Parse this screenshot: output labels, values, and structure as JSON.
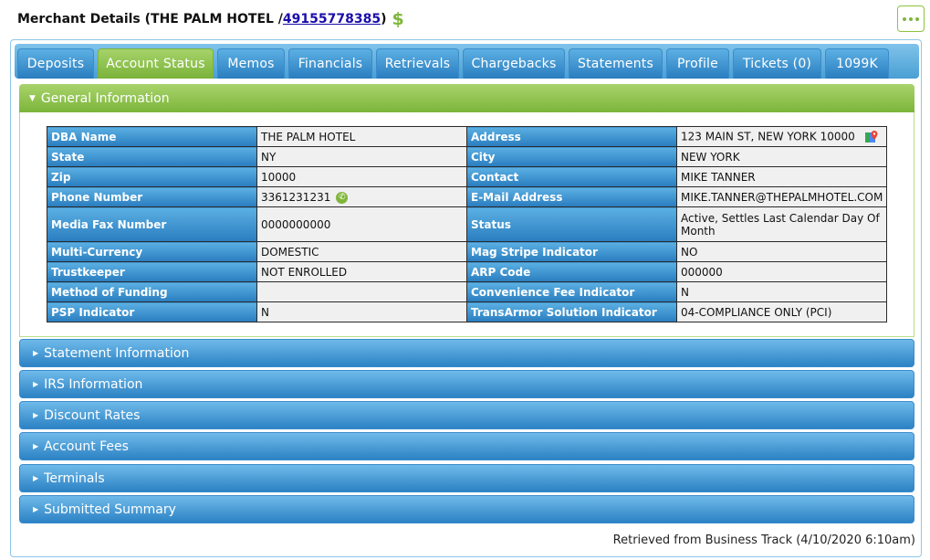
{
  "header": {
    "prefix": "Merchant Details (THE PALM HOTEL / ",
    "merchant_id": "49155778385",
    "suffix": ")",
    "dollar": "$"
  },
  "tabs": [
    {
      "label": "Deposits",
      "active": false
    },
    {
      "label": "Account Status",
      "active": true
    },
    {
      "label": "Memos",
      "active": false
    },
    {
      "label": "Financials",
      "active": false
    },
    {
      "label": "Retrievals",
      "active": false
    },
    {
      "label": "Chargebacks",
      "active": false
    },
    {
      "label": "Statements",
      "active": false
    },
    {
      "label": "Profile",
      "active": false
    },
    {
      "label": "Tickets (0)",
      "active": false
    },
    {
      "label": "1099K",
      "active": false
    }
  ],
  "general": {
    "title": "General Information",
    "rows": [
      {
        "l1": "DBA Name",
        "v1": "THE PALM HOTEL",
        "l2": "Address",
        "v2": "123 MAIN ST, NEW YORK 10000"
      },
      {
        "l1": "State",
        "v1": "NY",
        "l2": "City",
        "v2": "NEW YORK"
      },
      {
        "l1": "Zip",
        "v1": "10000",
        "l2": "Contact",
        "v2": "MIKE TANNER"
      },
      {
        "l1": "Phone Number",
        "v1": "3361231231",
        "l2": "E-Mail Address",
        "v2": "MIKE.TANNER@THEPALMHOTEL.COM"
      },
      {
        "l1": "Media Fax Number",
        "v1": "0000000000",
        "l2": "Status",
        "v2": "Active, Settles Last Calendar Day Of Month"
      },
      {
        "l1": "Multi-Currency",
        "v1": "DOMESTIC",
        "l2": "Mag Stripe Indicator",
        "v2": "NO"
      },
      {
        "l1": "Trustkeeper",
        "v1": "NOT ENROLLED",
        "l2": "ARP Code",
        "v2": "000000"
      },
      {
        "l1": "Method of Funding",
        "v1": "",
        "l2": "Convenience Fee Indicator",
        "v2": "N"
      },
      {
        "l1": "PSP Indicator",
        "v1": "N",
        "l2": "TransArmor Solution Indicator",
        "v2": "04-COMPLIANCE ONLY (PCI)"
      }
    ]
  },
  "sections": [
    "Statement Information",
    "IRS Information",
    "Discount Rates",
    "Account Fees",
    "Terminals",
    "Submitted Summary"
  ],
  "footer": "Retrieved from Business Track (4/10/2020 6:10am)",
  "icons": {
    "phone": "phone-icon",
    "map": "map-pin-icon",
    "more": "more-dots-icon",
    "dollar": "dollar-icon"
  },
  "colors": {
    "green": "#7fb63a",
    "blue": "#2a7dbf",
    "link": "#1a0dab"
  }
}
